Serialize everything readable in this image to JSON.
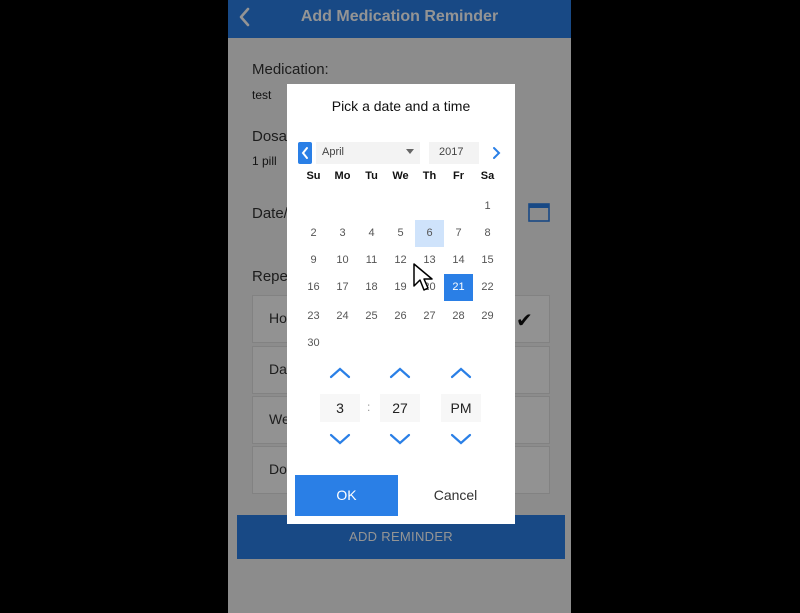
{
  "app": {
    "title": "Add Medication Reminder",
    "back_icon": "chevron-left-icon",
    "accent": "#2a7fe6"
  },
  "form": {
    "medication_label": "Medication:",
    "medication_value": "test",
    "dosage_label": "Dosa",
    "dosage_value": "1 pill",
    "date_label": "Date/",
    "repeat_label": "Repe",
    "repeat_options": [
      {
        "label": "Ho",
        "checked": true
      },
      {
        "label": "Da",
        "checked": false
      },
      {
        "label": "We",
        "checked": false
      },
      {
        "label": "Do",
        "checked": false
      }
    ],
    "add_button": "ADD REMINDER"
  },
  "picker": {
    "title": "Pick a date and a time",
    "month": "April",
    "year": "2017",
    "weekdays": [
      "Su",
      "Mo",
      "Tu",
      "We",
      "Th",
      "Fr",
      "Sa"
    ],
    "weeks": [
      [
        "",
        "",
        "",
        "",
        "",
        "",
        "1"
      ],
      [
        "2",
        "3",
        "4",
        "5",
        "6",
        "7",
        "8"
      ],
      [
        "9",
        "10",
        "11",
        "12",
        "13",
        "14",
        "15"
      ],
      [
        "16",
        "17",
        "18",
        "19",
        "20",
        "21",
        "22"
      ],
      [
        "23",
        "24",
        "25",
        "26",
        "27",
        "28",
        "29"
      ],
      [
        "30",
        "",
        "",
        "",
        "",
        "",
        ""
      ]
    ],
    "today": "6",
    "selected": "21",
    "time": {
      "hour": "3",
      "separator": ":",
      "minute": "27",
      "period": "PM"
    },
    "ok": "OK",
    "cancel": "Cancel"
  }
}
